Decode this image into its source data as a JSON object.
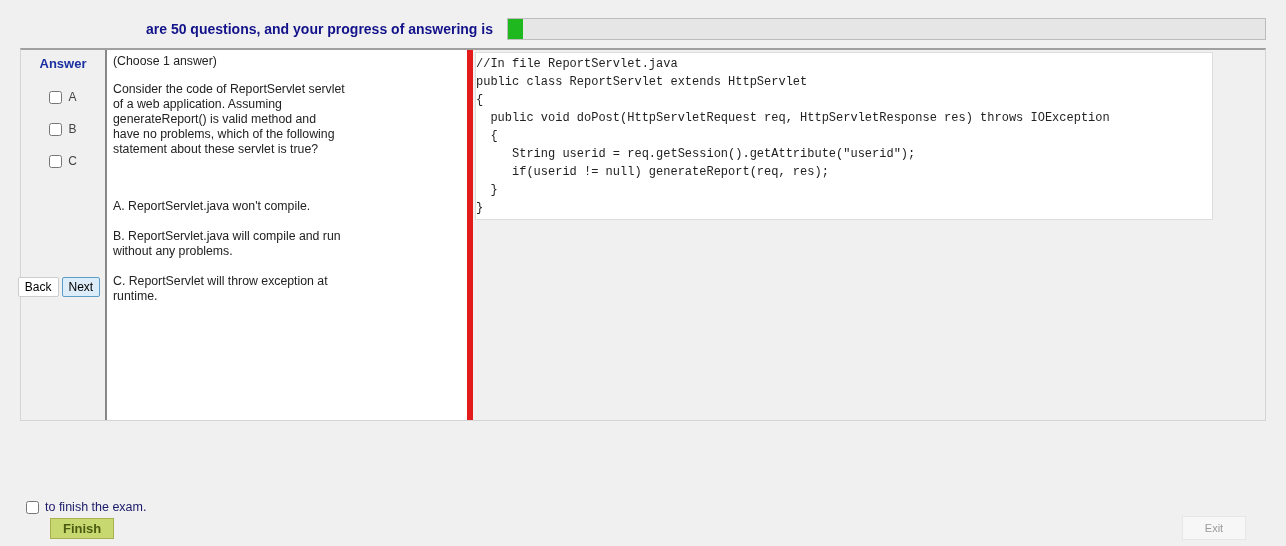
{
  "header": {
    "text": "are 50 questions, and your progress of answering is",
    "progress": {
      "level": 0.02
    }
  },
  "answer": {
    "title": "Answer",
    "options": [
      {
        "label": "A",
        "checked": false
      },
      {
        "label": "B",
        "checked": false
      },
      {
        "label": "C",
        "checked": false
      }
    ]
  },
  "navigation": {
    "buttons": [
      "Back",
      "Next"
    ]
  },
  "question": {
    "instruction": "(Choose 1 answer)",
    "text": "Consider the code of ReportServlet servlet of a web application. Assuming generateReport() is valid method and have no problems, which of the following statement about these servlet is true?",
    "choices": [
      "A.  ReportServlet.java won't compile.",
      "B.  ReportServlet.java  will compile and run without any problems.",
      "C.  ReportServlet will throw exception at runtime."
    ]
  },
  "code": [
    "//In file ReportServlet.java",
    "public class ReportServlet extends HttpServlet",
    "{",
    "  public void doPost(HttpServletRequest req, HttpServletResponse res) throws IOException",
    "  {",
    "     String userid = req.getSession().getAttribute(\"userid\");",
    "     if(userid != null) generateReport(req, res);",
    "  }",
    "}"
  ],
  "finish": {
    "label": "to finish the exam.",
    "checked": false,
    "button": "Finish"
  },
  "exit": {
    "label": "Exit",
    "disabled": true
  }
}
